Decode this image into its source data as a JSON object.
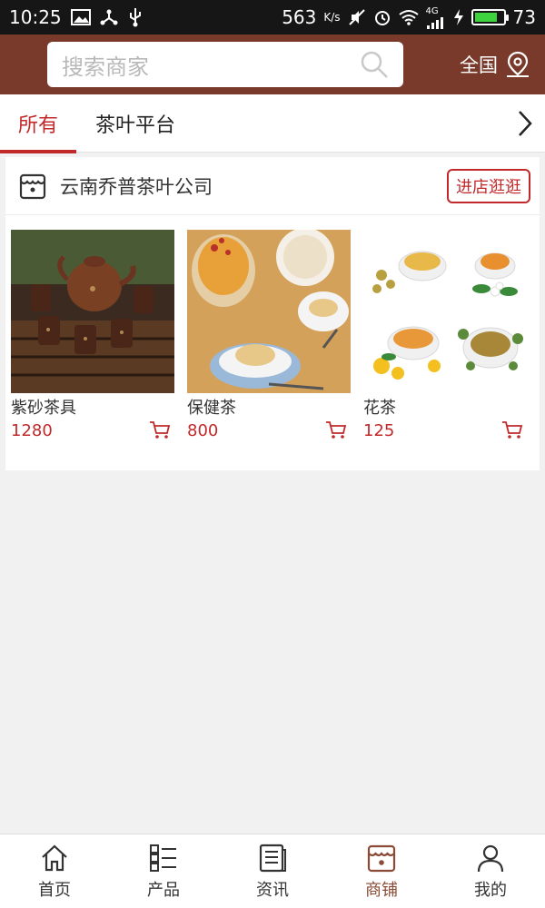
{
  "status_bar": {
    "time": "10:25",
    "speed": "563",
    "speed_unit": "K/s",
    "network": "4G",
    "battery": "73"
  },
  "header": {
    "search_placeholder": "搜索商家",
    "region_label": "全国"
  },
  "tabs": [
    {
      "label": "所有",
      "active": true
    },
    {
      "label": "茶叶平台",
      "active": false
    }
  ],
  "shop": {
    "name": "云南乔普茶叶公司",
    "visit_label": "进店逛逛"
  },
  "products": [
    {
      "name": "紫砂茶具",
      "price": "1280",
      "image": "purple-clay-tea-set"
    },
    {
      "name": "保健茶",
      "price": "800",
      "image": "health-tea-cups"
    },
    {
      "name": "花茶",
      "price": "125",
      "image": "flower-tea-cups"
    }
  ],
  "bottom_nav": [
    {
      "label": "首页",
      "icon": "home-icon",
      "active": false
    },
    {
      "label": "产品",
      "icon": "list-icon",
      "active": false
    },
    {
      "label": "资讯",
      "icon": "news-icon",
      "active": false
    },
    {
      "label": "商铺",
      "icon": "shop-icon",
      "active": true
    },
    {
      "label": "我的",
      "icon": "user-icon",
      "active": false
    }
  ],
  "colors": {
    "header_bg": "#7a3a2b",
    "accent_red": "#c2292a",
    "nav_active": "#8a4a36"
  }
}
